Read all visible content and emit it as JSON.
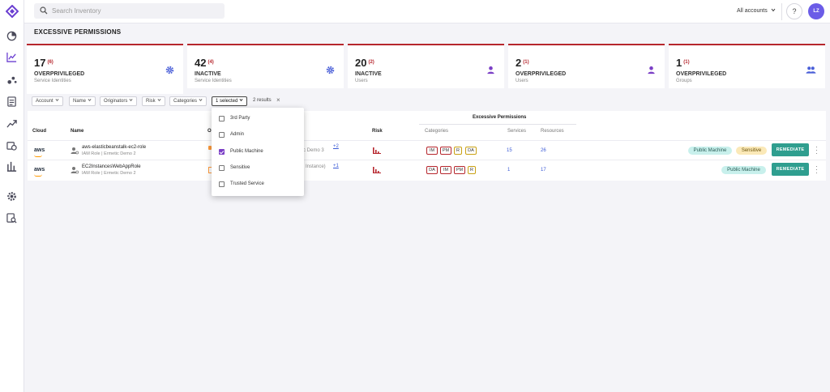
{
  "search": {
    "placeholder": "Search Inventory"
  },
  "header": {
    "accounts_label": "All accounts",
    "help_label": "?",
    "avatar_initials": "LZ"
  },
  "page": {
    "title": "EXCESSIVE PERMISSIONS"
  },
  "cards": [
    {
      "count": "17",
      "sub": "(6)",
      "label": "OVERPRIVILEGED",
      "desc": "Service Identities",
      "icon": "gear-icon"
    },
    {
      "count": "42",
      "sub": "(4)",
      "label": "INACTIVE",
      "desc": "Service Identities",
      "icon": "gear-icon"
    },
    {
      "count": "20",
      "sub": "(2)",
      "label": "INACTIVE",
      "desc": "Users",
      "icon": "user-icon"
    },
    {
      "count": "2",
      "sub": "(1)",
      "label": "OVERPRIVILEGED",
      "desc": "Users",
      "icon": "user-icon"
    },
    {
      "count": "1",
      "sub": "(1)",
      "label": "OVERPRIVILEGED",
      "desc": "Groups",
      "icon": "group-icon"
    }
  ],
  "filters": {
    "chips": [
      "Account",
      "Name",
      "Originators",
      "Risk",
      "Categories",
      "1 selected"
    ],
    "results": "2 results",
    "clear": "×"
  },
  "dropdown": {
    "options": [
      {
        "label": "3rd Party",
        "checked": false
      },
      {
        "label": "Admin",
        "checked": false
      },
      {
        "label": "Public Machine",
        "checked": true
      },
      {
        "label": "Sensitive",
        "checked": false
      },
      {
        "label": "Trusted Service",
        "checked": false
      }
    ]
  },
  "table": {
    "group_header": "Excessive Permissions",
    "columns": {
      "cloud": "Cloud",
      "name": "Name",
      "originators": "O",
      "risk": "Risk",
      "categories": "Categories",
      "services": "Services",
      "resources": "Resources"
    },
    "rows": [
      {
        "cloud": "aws",
        "name": "aws-elasticbeanstalk-ec2-role",
        "type": "IAM Role | Ermetic Demo 2",
        "origin_text": "tic Demo 3",
        "origin_more": "+2",
        "categories": [
          "IM",
          "PM",
          "R",
          "DA"
        ],
        "services": "15",
        "resources": "26",
        "tags": [
          "Public Machine",
          "Sensitive"
        ],
        "action": "REMEDIATE"
      },
      {
        "cloud": "aws",
        "name": "EC2InstancesWebAppRole",
        "type": "IAM Role | Ermetic Demo 2",
        "origin_text": "2 Instance)",
        "origin_more": "+1",
        "categories": [
          "DA",
          "IM",
          "PM",
          "R"
        ],
        "services": "1",
        "resources": "17",
        "tags": [
          "Public Machine"
        ],
        "action": "REMEDIATE"
      }
    ]
  },
  "colors": {
    "accent": "#6b3fd1",
    "alert": "#b6262d",
    "remediate": "#2f9e8f",
    "public_tag": "#c8f0ec",
    "sensitive_tag": "#fbe9b8"
  }
}
